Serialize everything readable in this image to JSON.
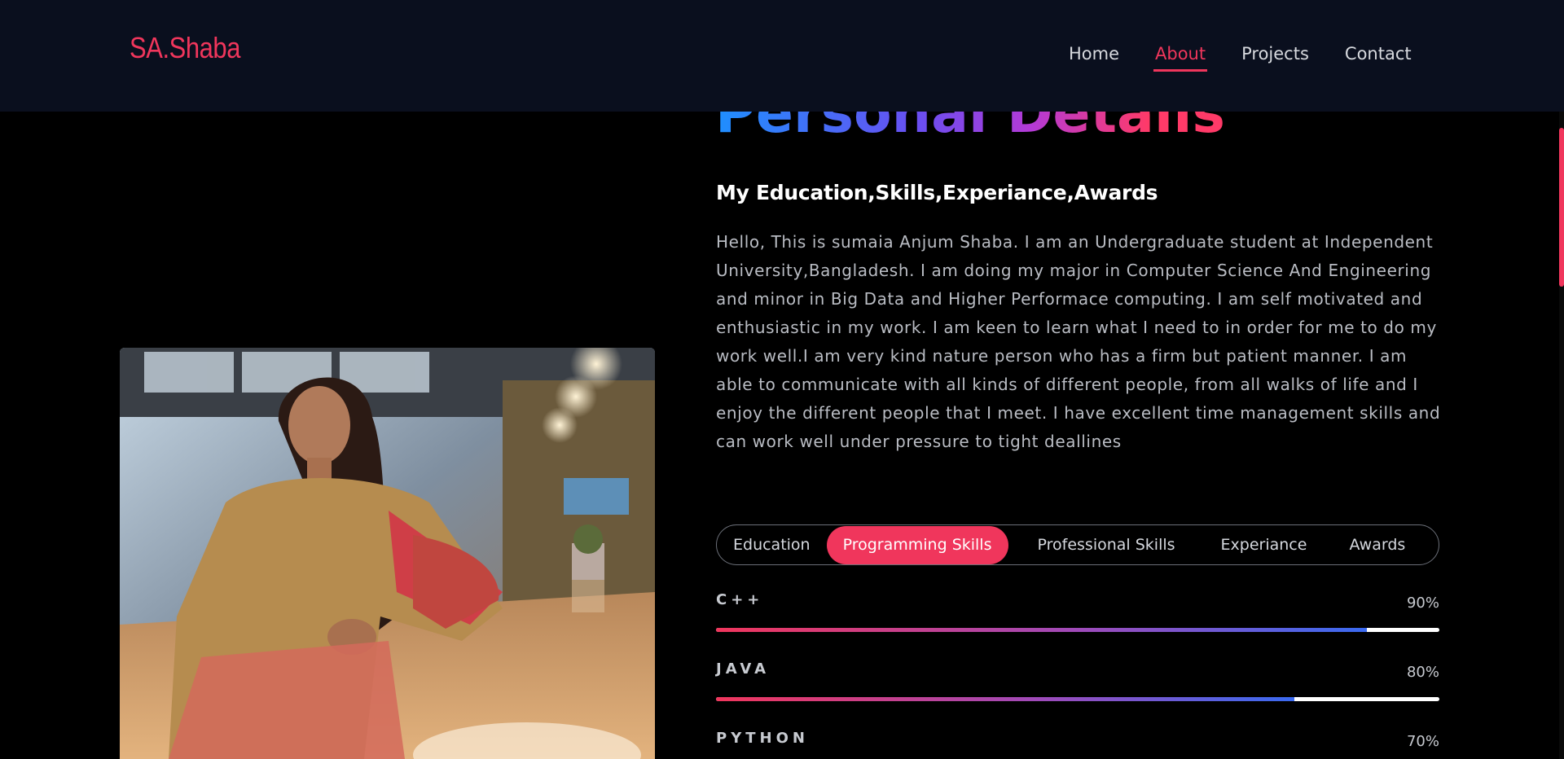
{
  "nav": {
    "logo": "SA.Shaba",
    "links": [
      {
        "label": "Home",
        "active": false
      },
      {
        "label": "About",
        "active": true
      },
      {
        "label": "Projects",
        "active": false
      },
      {
        "label": "Contact",
        "active": false
      }
    ]
  },
  "about": {
    "title": "Personal Details",
    "subtitle": "My Education,Skills,Experiance,Awards",
    "bio": "Hello, This is sumaia Anjum Shaba. I am an Undergraduate student at Independent University,Bangladesh. I am doing my major in Computer Science And Engineering and minor in Big Data and Higher Performace computing. I am self motivated and enthusiastic in my work. I am keen to learn what I need to in order for me to do my work well.I am very kind nature person who has a firm but patient manner. I am able to communicate with all kinds of different people, from all walks of life and I enjoy the different people that I meet. I have excellent time management skills and can work well under pressure to tight deallines"
  },
  "tabs": [
    {
      "label": "Education",
      "active": false
    },
    {
      "label": "Programming Skills",
      "active": true
    },
    {
      "label": "Professional Skills",
      "active": false
    },
    {
      "label": "Experiance",
      "active": false
    },
    {
      "label": "Awards",
      "active": false
    }
  ],
  "skills": [
    {
      "name": "C++",
      "percent_label": "90%",
      "level": 0.9
    },
    {
      "name": "JAVA",
      "percent_label": "80%",
      "level": 0.8
    },
    {
      "name": "PYTHON",
      "percent_label": "70%",
      "level": 0.7
    }
  ],
  "colors": {
    "accent": "#f0365c",
    "navbar_bg": "#0a0f1e",
    "page_bg": "#000000"
  }
}
